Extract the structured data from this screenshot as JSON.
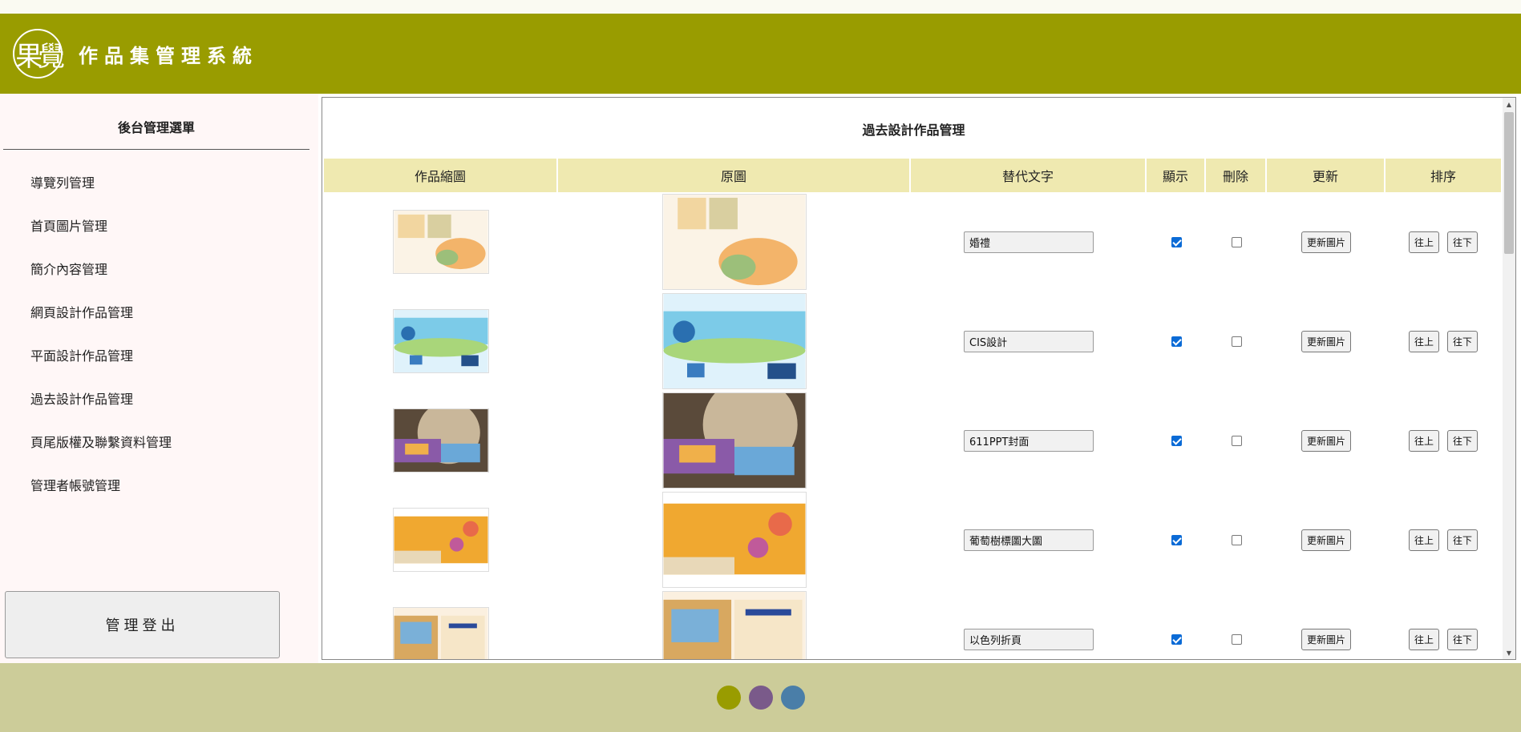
{
  "header": {
    "logo_text": "果覺",
    "title": "作品集管理系統"
  },
  "sidebar": {
    "title": "後台管理選單",
    "items": [
      {
        "label": "導覽列管理"
      },
      {
        "label": "首頁圖片管理"
      },
      {
        "label": "簡介內容管理"
      },
      {
        "label": "網頁設計作品管理"
      },
      {
        "label": "平面設計作品管理"
      },
      {
        "label": "過去設計作品管理"
      },
      {
        "label": "頁尾版權及聯繫資料管理"
      },
      {
        "label": "管理者帳號管理"
      }
    ],
    "logout_label": "管理登出"
  },
  "main": {
    "title": "過去設計作品管理",
    "columns": [
      "作品縮圖",
      "原圖",
      "替代文字",
      "顯示",
      "刪除",
      "更新",
      "排序"
    ],
    "update_label": "更新圖片",
    "up_label": "往上",
    "down_label": "往下",
    "rows": [
      {
        "alt": "婚禮",
        "show": true,
        "delete": false
      },
      {
        "alt": "CIS設計",
        "show": true,
        "delete": false
      },
      {
        "alt": "611PPT封面",
        "show": true,
        "delete": false
      },
      {
        "alt": "葡萄樹標圖大圖",
        "show": true,
        "delete": false
      },
      {
        "alt": "以色列折頁",
        "show": true,
        "delete": false
      }
    ]
  },
  "footer": {
    "dot_colors": [
      "#999c00",
      "#7a5a8a",
      "#4a7ea8"
    ]
  },
  "colors": {
    "header": "#999c00",
    "footer": "#cccc99",
    "sidebar_bg": "#fff7f7",
    "table_head": "#efe9b0"
  }
}
